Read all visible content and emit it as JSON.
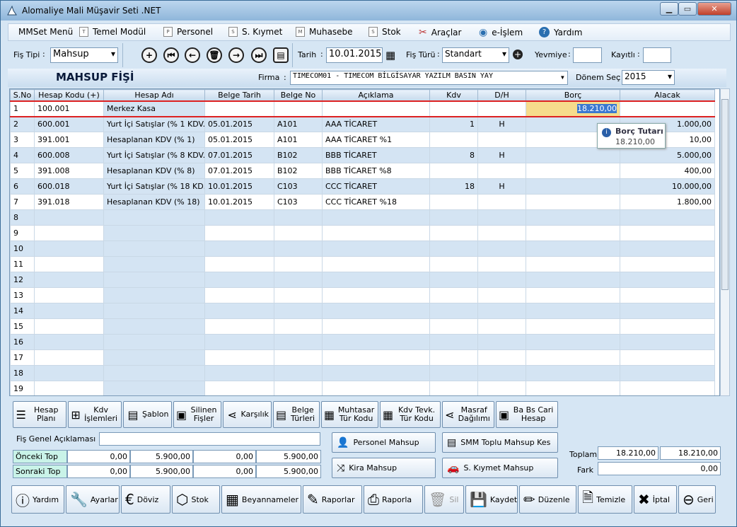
{
  "window": {
    "title": "Alomaliye Mali Müşavir Seti .NET"
  },
  "menu": [
    {
      "label": "MMSet Menü",
      "icon": ""
    },
    {
      "label": "Temel Modül",
      "icon": "T"
    },
    {
      "label": "Personel",
      "icon": "P"
    },
    {
      "label": "S. Kıymet",
      "icon": "S"
    },
    {
      "label": "Muhasebe",
      "icon": "M"
    },
    {
      "label": "Stok",
      "icon": "S"
    },
    {
      "label": "Araçlar",
      "icon": "tools"
    },
    {
      "label": "e-İşlem",
      "icon": "globe"
    },
    {
      "label": "Yardım",
      "icon": "help"
    }
  ],
  "toolbar": {
    "fis_tipi_label": "Fiş Tipi",
    "fis_tipi_value": "Mahsup",
    "tarih_label": "Tarih",
    "tarih_value": "10.01.2015",
    "fis_turu_label": "Fiş Türü",
    "fis_turu_value": "Standart",
    "yevmiye_label": "Yevmiye",
    "yevmiye_value": "",
    "kayitli_label": "Kayıtlı",
    "kayitli_value": ""
  },
  "header": {
    "title": "MAHSUP FİŞİ",
    "firma_label": "Firma",
    "firma_value": "TIMECOM01        - TIMECOM BİLGİSAYAR YAZILM BASIN YAY",
    "donem_label": "Dönem Seç",
    "donem_value": "2015"
  },
  "grid": {
    "columns": [
      "S.No",
      "Hesap Kodu (+)",
      "Hesap Adı",
      "Belge Tarih",
      "Belge No",
      "Açıklama",
      "Kdv",
      "D/H",
      "Borç",
      "Alacak"
    ],
    "rows": [
      [
        "1",
        "100.001",
        "Merkez Kasa",
        "",
        "",
        "",
        "",
        "",
        "18.210,00",
        ""
      ],
      [
        "2",
        "600.001",
        "Yurt İçi Satışlar (% 1 KDV.li)",
        "05.01.2015",
        "A101",
        "AAA TİCARET",
        "1",
        "H",
        "",
        "1.000,00"
      ],
      [
        "3",
        "391.001",
        "Hesaplanan KDV (% 1)",
        "05.01.2015",
        "A101",
        "AAA TİCARET %1",
        "",
        "",
        "",
        "10,00"
      ],
      [
        "4",
        "600.008",
        "Yurt İçi Satışlar (% 8 KDV.li)",
        "07.01.2015",
        "B102",
        "BBB TİCARET",
        "8",
        "H",
        "",
        "5.000,00"
      ],
      [
        "5",
        "391.008",
        "Hesaplanan KDV (% 8)",
        "07.01.2015",
        "B102",
        "BBB TİCARET %8",
        "",
        "",
        "",
        "400,00"
      ],
      [
        "6",
        "600.018",
        "Yurt İçi Satışlar (% 18 KD...",
        "10.01.2015",
        "C103",
        "CCC TİCARET",
        "18",
        "H",
        "",
        "10.000,00"
      ],
      [
        "7",
        "391.018",
        "Hesaplanan KDV (% 18)",
        "10.01.2015",
        "C103",
        "CCC TİCARET %18",
        "",
        "",
        "",
        "1.800,00"
      ],
      [
        "8",
        "",
        "",
        "",
        "",
        "",
        "",
        "",
        "",
        ""
      ],
      [
        "9",
        "",
        "",
        "",
        "",
        "",
        "",
        "",
        "",
        ""
      ],
      [
        "10",
        "",
        "",
        "",
        "",
        "",
        "",
        "",
        "",
        ""
      ],
      [
        "11",
        "",
        "",
        "",
        "",
        "",
        "",
        "",
        "",
        ""
      ],
      [
        "12",
        "",
        "",
        "",
        "",
        "",
        "",
        "",
        "",
        ""
      ],
      [
        "13",
        "",
        "",
        "",
        "",
        "",
        "",
        "",
        "",
        ""
      ],
      [
        "14",
        "",
        "",
        "",
        "",
        "",
        "",
        "",
        "",
        ""
      ],
      [
        "15",
        "",
        "",
        "",
        "",
        "",
        "",
        "",
        "",
        ""
      ],
      [
        "16",
        "",
        "",
        "",
        "",
        "",
        "",
        "",
        "",
        ""
      ],
      [
        "17",
        "",
        "",
        "",
        "",
        "",
        "",
        "",
        "",
        ""
      ],
      [
        "18",
        "",
        "",
        "",
        "",
        "",
        "",
        "",
        "",
        ""
      ],
      [
        "19",
        "",
        "",
        "",
        "",
        "",
        "",
        "",
        "",
        ""
      ]
    ],
    "tooltip_title": "Borç Tutarı",
    "tooltip_value": "18.210,00"
  },
  "action_buttons": [
    {
      "label": "Hesap Planı",
      "icon": "list"
    },
    {
      "label": "Kdv İşlemleri",
      "icon": "calc"
    },
    {
      "label": "Şablon",
      "icon": "template"
    },
    {
      "label": "Silinen Fişler",
      "icon": "deleted"
    },
    {
      "label": "Karşılık",
      "icon": "share"
    },
    {
      "label": "Belge Türleri",
      "icon": "doc"
    },
    {
      "label": "Muhtasar Tür Kodu",
      "icon": "calendar"
    },
    {
      "label": "Kdv Tevk. Tür Kodu",
      "icon": "calendar"
    },
    {
      "label": "Masraf Dağılımı",
      "icon": "share"
    },
    {
      "label": "Ba Bs Cari Hesap",
      "icon": "add-doc"
    }
  ],
  "footer": {
    "aciklama_label": "Fiş Genel Açıklaması",
    "aciklama_value": "",
    "onceki_label": "Önceki Top",
    "onceki": [
      "0,00",
      "5.900,00",
      "0,00",
      "5.900,00"
    ],
    "sonraki_label": "Sonraki Top",
    "sonraki": [
      "0,00",
      "5.900,00",
      "0,00",
      "5.900,00"
    ],
    "personel_mahsup": "Personel Mahsup",
    "smm_mahsup": "SMM Toplu Mahsup Kes",
    "kira_mahsup": "Kira Mahsup",
    "skiymet_mahsup": "S. Kıymet Mahsup",
    "toplam_label": "Toplam",
    "toplam_borc": "18.210,00",
    "toplam_alacak": "18.210,00",
    "fark_label": "Fark",
    "fark_value": "0,00"
  },
  "bottom_bar": [
    {
      "label": "Yardım",
      "icon": "info"
    },
    {
      "label": "Ayarlar",
      "icon": "wrench"
    },
    {
      "label": "Döviz",
      "icon": "currency"
    },
    {
      "label": "Stok",
      "icon": "boxes"
    },
    {
      "label": "Beyannameler",
      "icon": "calendar"
    },
    {
      "label": "Raporlar",
      "icon": "report"
    },
    {
      "label": "Raporla",
      "icon": "printer"
    },
    {
      "label": "Sil",
      "icon": "trash"
    },
    {
      "label": "Kaydet",
      "icon": "save"
    },
    {
      "label": "Düzenle",
      "icon": "pencil"
    },
    {
      "label": "Temizle",
      "icon": "page"
    },
    {
      "label": "İptal",
      "icon": "cross"
    },
    {
      "label": "Geri",
      "icon": "back"
    }
  ]
}
